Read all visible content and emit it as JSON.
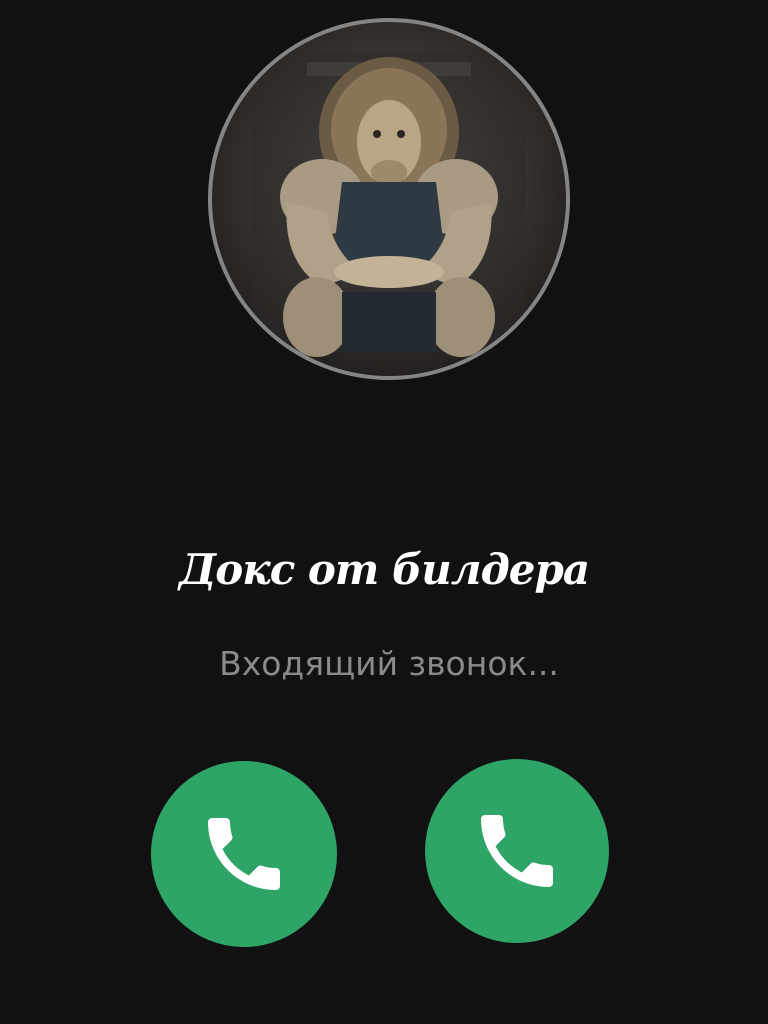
{
  "call": {
    "caller_name": "Докс от билдера",
    "status": "Входящий звонок..."
  },
  "avatar": {
    "icon": "lion-bodybuilder-avatar"
  },
  "buttons": {
    "left": {
      "icon": "phone-icon"
    },
    "right": {
      "icon": "phone-icon"
    }
  },
  "colors": {
    "background": "#121112",
    "avatar_ring": "#858585",
    "call_button": "#2ea567",
    "name_text": "#ffffff",
    "status_text": "#8a8a8a"
  }
}
